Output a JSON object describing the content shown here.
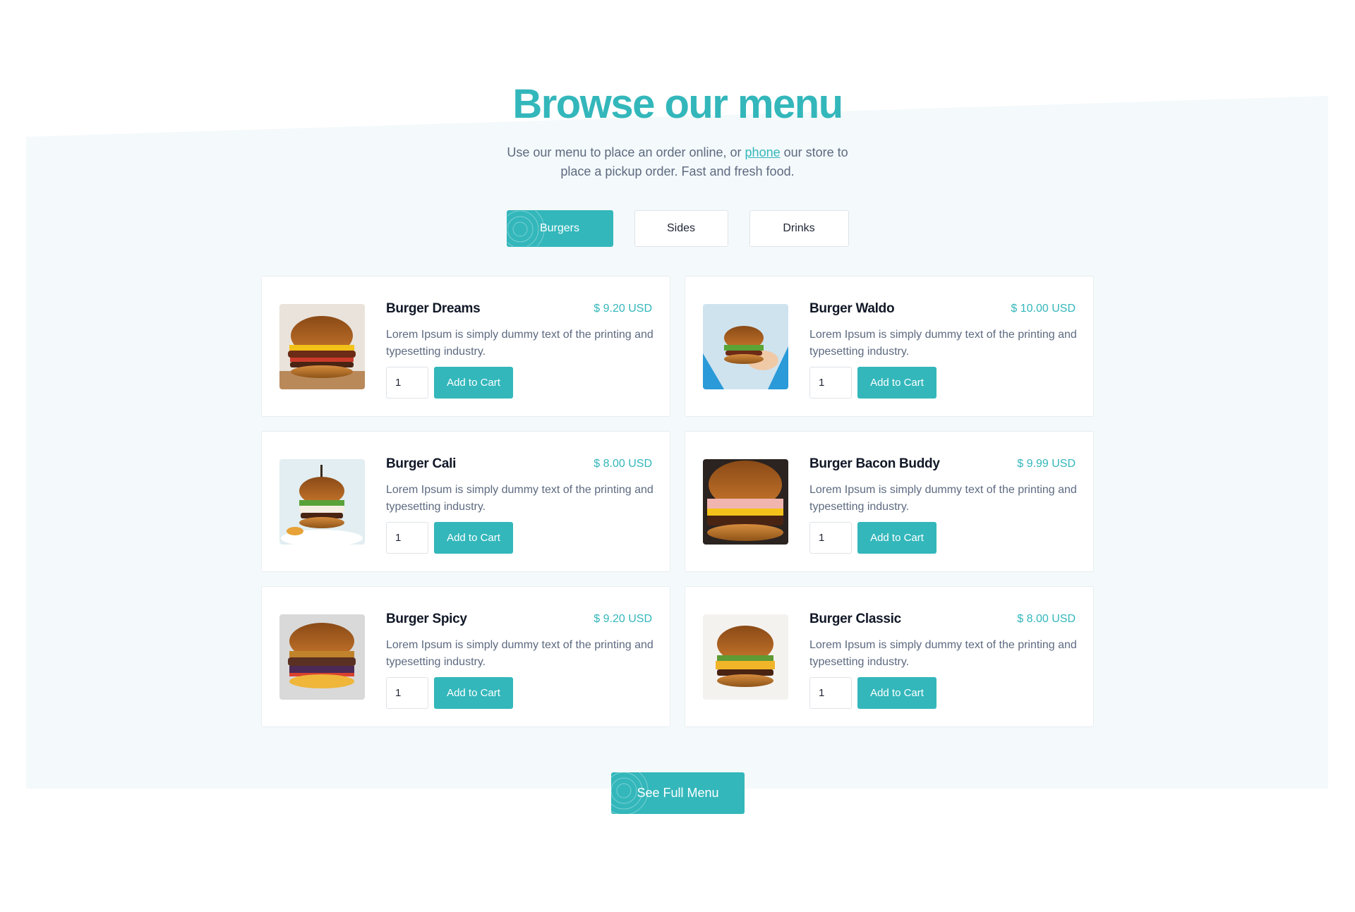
{
  "hero": {
    "title": "Browse our menu",
    "text_before_link": "Use our menu to place an order online, or ",
    "link_text": "phone",
    "text_after_link": " our store to place a pickup order. Fast and fresh food."
  },
  "tabs": [
    {
      "label": "Burgers",
      "active": true
    },
    {
      "label": "Sides",
      "active": false
    },
    {
      "label": "Drinks",
      "active": false
    }
  ],
  "items": [
    {
      "name": "Burger Dreams",
      "price": "$ 9.20 USD",
      "description": "Lorem Ipsum is simply dummy text of the printing and typesetting industry.",
      "quantity": "1",
      "button": "Add to Cart",
      "image": "burger-photo-icon"
    },
    {
      "name": "Burger Waldo",
      "price": "$ 10.00 USD",
      "description": "Lorem Ipsum is simply dummy text of the printing and typesetting industry.",
      "quantity": "1",
      "button": "Add to Cart",
      "image": "burger-photo-icon"
    },
    {
      "name": "Burger Cali",
      "price": "$ 8.00 USD",
      "description": "Lorem Ipsum is simply dummy text of the printing and typesetting industry.",
      "quantity": "1",
      "button": "Add to Cart",
      "image": "burger-photo-icon"
    },
    {
      "name": "Burger Bacon Buddy",
      "price": "$ 9.99 USD",
      "description": "Lorem Ipsum is simply dummy text of the printing and typesetting industry.",
      "quantity": "1",
      "button": "Add to Cart",
      "image": "burger-photo-icon"
    },
    {
      "name": "Burger Spicy",
      "price": "$ 9.20 USD",
      "description": "Lorem Ipsum is simply dummy text of the printing and typesetting industry.",
      "quantity": "1",
      "button": "Add to Cart",
      "image": "burger-photo-icon"
    },
    {
      "name": "Burger Classic",
      "price": "$ 8.00 USD",
      "description": "Lorem Ipsum is simply dummy text of the printing and typesetting industry.",
      "quantity": "1",
      "button": "Add to Cart",
      "image": "burger-photo-icon"
    }
  ],
  "cta": {
    "label": "See Full Menu"
  },
  "colors": {
    "accent": "#33b7bb",
    "band": "#f4f9fb",
    "heading": "#111827",
    "body": "#5d6a80"
  }
}
